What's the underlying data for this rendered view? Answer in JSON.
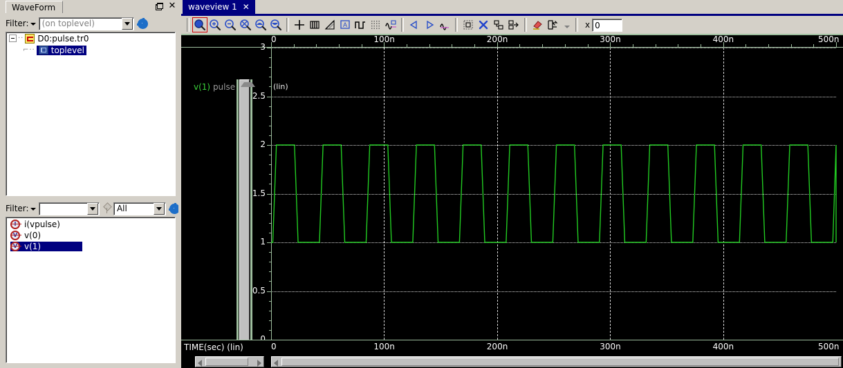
{
  "left_panel": {
    "title": "WaveForm",
    "titlebar_buttons": [
      {
        "name": "restore",
        "glyph": ""
      },
      {
        "name": "close",
        "glyph": "✕"
      }
    ],
    "top_filter": {
      "label": "Filter:",
      "value": "",
      "placeholder": "(on toplevel)",
      "gear_icon": "gear-icon"
    },
    "tree": [
      {
        "label": "D0:pulse.tr0",
        "icon": "waveform-file-icon",
        "level": 0,
        "selected": false,
        "expanded": true
      },
      {
        "label": "toplevel",
        "icon": "module-icon",
        "level": 1,
        "selected": true,
        "expanded": false
      }
    ],
    "bottom_filter": {
      "label": "Filter:",
      "value": "",
      "scope_value": "All",
      "pin_icon": "pin-icon",
      "gear_icon": "gear-icon"
    },
    "signals": [
      {
        "label": "i(vpulse)",
        "icon": "current-signal-icon",
        "selected": false
      },
      {
        "label": "v(0)",
        "icon": "voltage-signal-icon",
        "selected": false
      },
      {
        "label": "v(1)",
        "icon": "voltage-signal-icon",
        "selected": true
      }
    ]
  },
  "waveview": {
    "tab_label": "waveview 1",
    "tab_close": "✕",
    "toolbar": [
      {
        "name": "zoom-fit-button",
        "tooltip": "Zoom Fit",
        "active": true
      },
      {
        "name": "zoom-in-button",
        "tooltip": "Zoom In",
        "active": false
      },
      {
        "name": "zoom-out-button",
        "tooltip": "Zoom Out",
        "active": false
      },
      {
        "name": "zoom-area-button",
        "tooltip": "Zoom Area",
        "active": false
      },
      {
        "name": "zoom-x-button",
        "tooltip": "Zoom X",
        "active": false
      },
      {
        "name": "zoom-y-button",
        "tooltip": "Zoom Y",
        "active": false
      },
      {
        "name": "cursor-crosshair-button",
        "tooltip": "Crosshair Cursor",
        "active": false
      },
      {
        "name": "vertical-bars-button",
        "tooltip": "Vertical Markers",
        "active": false
      },
      {
        "name": "measure-slope-button",
        "tooltip": "Measure Slope",
        "active": false
      },
      {
        "name": "annotate-text-button",
        "tooltip": "Add Annotation",
        "active": false
      },
      {
        "name": "digital-waveform-button",
        "tooltip": "Digital View",
        "active": false
      },
      {
        "name": "grid-toggle-button",
        "tooltip": "Toggle Grid",
        "active": false
      },
      {
        "name": "add-waveform-button",
        "tooltip": "Add Waveform",
        "active": false
      },
      {
        "name": "previous-button",
        "tooltip": "Previous",
        "active": false
      },
      {
        "name": "next-button",
        "tooltip": "Next",
        "active": false
      },
      {
        "name": "waveform-marker-button",
        "tooltip": "Waveform Marker",
        "active": false
      },
      {
        "name": "select-region-button",
        "tooltip": "Select Region",
        "active": false
      },
      {
        "name": "delete-button",
        "tooltip": "Delete",
        "active": false
      },
      {
        "name": "group-button",
        "tooltip": "Group",
        "active": false
      },
      {
        "name": "ungroup-button",
        "tooltip": "Ungroup",
        "active": false
      },
      {
        "name": "erase-button",
        "tooltip": "Erase",
        "active": false
      },
      {
        "name": "panel-layout-button",
        "tooltip": "Panel Layout",
        "active": false
      }
    ],
    "x_field": {
      "label": "x",
      "value": "0"
    },
    "channel_label_signal": "v(1)",
    "channel_label_dataset": "pulse",
    "y_scale_note": "(lin)",
    "x_axis_name": "TIME(sec)  (lin)"
  },
  "chart_data": {
    "type": "line",
    "title": "",
    "xlabel": "TIME(sec)  (lin)",
    "ylabel": "",
    "ylim": [
      0,
      3
    ],
    "xlim": [
      0,
      500
    ],
    "x_unit": "n",
    "x_ticks": [
      0,
      100,
      200,
      300,
      400,
      500
    ],
    "x_tick_labels": [
      "0",
      "100n",
      "200n",
      "300n",
      "400n",
      "500n"
    ],
    "x_minor_per_major": 5,
    "y_ticks": [
      0,
      0.5,
      1,
      1.5,
      2,
      2.5,
      3
    ],
    "y_tick_labels": [
      "0",
      "0.5",
      "1",
      "1.5",
      "2",
      "2.5",
      "3"
    ],
    "y_minor_per_major": 5,
    "grid": {
      "horizontal": "dotted",
      "vertical": "dashed",
      "color": "#d8d8d8"
    },
    "background": "#000000",
    "axis_color": "#9fbf9f",
    "series": [
      {
        "name": "v(1) pulse",
        "color": "#22cc22",
        "low_value": 1,
        "high_value": 2,
        "period_ns": 41.3,
        "pulse_width_ns": 16,
        "rise_time_ns": 3.2,
        "fall_time_ns": 3.2,
        "delay_ns": 1.5,
        "num_pulses": 12,
        "waveform_shape": "trapezoidal-pulse-train"
      }
    ]
  }
}
